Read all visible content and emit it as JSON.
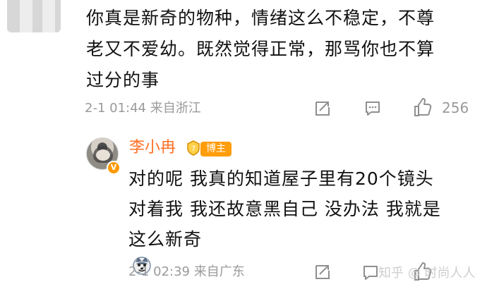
{
  "comment_1": {
    "avatar": "blurred-avatar",
    "text_lines": [
      "你真是新奇的物种，情绪这么不稳定，不尊",
      "老又不爱幼。既然觉得正常，那骂你也不算",
      "过分的事"
    ],
    "meta": "2-1 01:44  来自浙江",
    "like_count": "256",
    "icons": {
      "share": "share-icon",
      "comment": "comment-icon",
      "like": "like-icon"
    }
  },
  "reply": {
    "username": "李小冉",
    "level_label": "7",
    "blogger_badge": "博主",
    "text_lines": [
      "对的呢 我真的知道屋子里有20个镜头",
      "对着我 我还故意黑自己 没办法 我就是",
      "这么新奇"
    ],
    "emoji": "dog-emoji",
    "meta": "2-1 02:39  来自广东",
    "watermark": "知乎 @ 时尚人人",
    "icons": {
      "share": "share-icon",
      "comment": "comment-icon",
      "like": "like-icon"
    }
  },
  "colors": {
    "text": "#111111",
    "meta": "#9a9a9a",
    "username": "#ff6f25",
    "badge": "#ff9d0a"
  }
}
